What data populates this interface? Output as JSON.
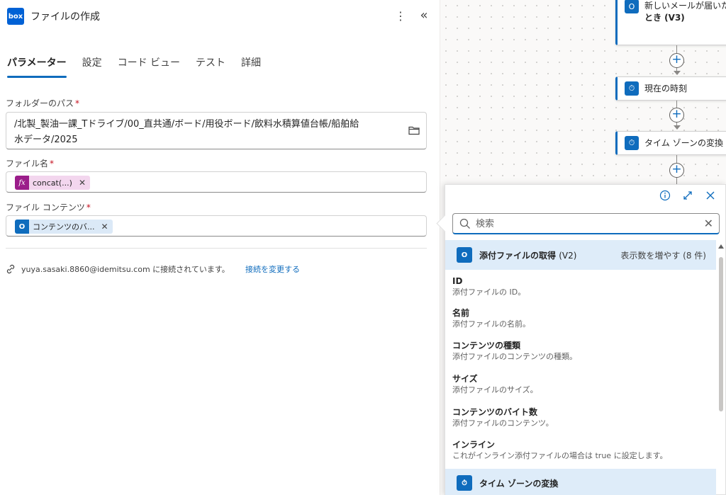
{
  "header": {
    "logo_text": "box",
    "title": "ファイルの作成",
    "more_glyph": "⋮",
    "collapse_glyph": "«"
  },
  "tabs": [
    {
      "label": "パラメーター",
      "active": true
    },
    {
      "label": "設定",
      "active": false
    },
    {
      "label": "コード ビュー",
      "active": false
    },
    {
      "label": "テスト",
      "active": false
    },
    {
      "label": "詳細",
      "active": false
    }
  ],
  "fields": {
    "folder_path": {
      "label": "フォルダーのパス",
      "required": "*",
      "value_line1": "/北製_製油一課_Tドライブ/00_直共通/ボード/用役ボード/飲料水積算値台帳/船舶給",
      "value_line2": "水データ/2025"
    },
    "file_name": {
      "label": "ファイル名",
      "required": "*",
      "token_icon": "fx",
      "token_text": "concat(...)",
      "token_remove": "✕"
    },
    "file_content": {
      "label": "ファイル コンテンツ",
      "required": "*",
      "token_icon": "O",
      "token_text": "コンテンツのバ...",
      "token_remove": "✕"
    }
  },
  "connection": {
    "text": "yuya.sasaki.8860@idemitsu.com に接続されています。",
    "change_link": "接続を変更する"
  },
  "canvas": {
    "cards": [
      {
        "line1": "新しいメールが届いた",
        "line2": "とき (V3)",
        "icon": "O"
      },
      {
        "line1": "現在の時刻",
        "icon": "⏱"
      },
      {
        "line1": "タイム ゾーンの変換",
        "icon": "⏱"
      }
    ],
    "plus_glyph": "+"
  },
  "popover": {
    "search_placeholder": "検索",
    "clear_glyph": "✕",
    "sections": [
      {
        "title": "添付ファイルの取得",
        "version": "(V2)",
        "icon": "O",
        "more": "表示数を増やす (8 件)"
      },
      {
        "title": "タイム ゾーンの変換",
        "version": "",
        "icon": "⏱",
        "more": ""
      }
    ],
    "items": [
      {
        "name": "ID",
        "desc": "添付ファイルの ID。"
      },
      {
        "name": "名前",
        "desc": "添付ファイルの名前。"
      },
      {
        "name": "コンテンツの種類",
        "desc": "添付ファイルのコンテンツの種類。"
      },
      {
        "name": "サイズ",
        "desc": "添付ファイルのサイズ。"
      },
      {
        "name": "コンテンツのバイト数",
        "desc": "添付ファイルのコンテンツ。"
      },
      {
        "name": "インライン",
        "desc": "これがインライン添付ファイルの場合は true に設定します。"
      }
    ]
  },
  "colors": {
    "accent": "#0f6cbd",
    "fx_token": "#9b1d8a",
    "section_bg": "#deecf9"
  }
}
